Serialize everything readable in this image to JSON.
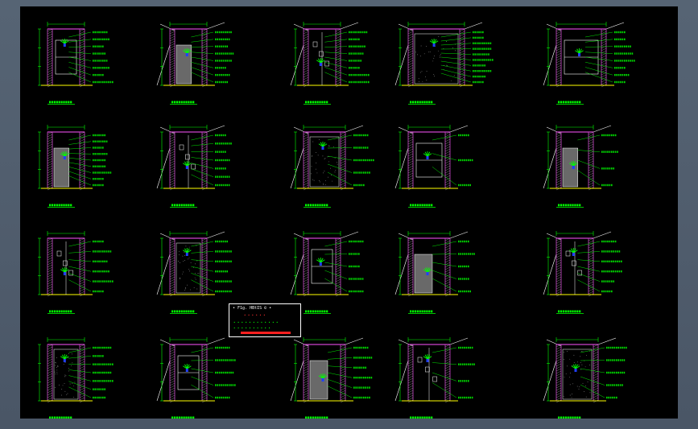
{
  "window": {
    "background": "#4d5a6a",
    "drawing_background": "#000000"
  },
  "colors": {
    "wall": "#cc44cc",
    "wall_hatch": "#ffffff",
    "leader": "#00ff00",
    "dimension": "#00ff00",
    "outline": "#ffffff",
    "accent": "#ff2020",
    "floor": "#ffff00"
  },
  "legend": {
    "line1": "• F1g. HBtIS © •",
    "line2": "• • • • • •",
    "line3": "• • • • • • • • • • • •",
    "line4": "• • • • • • • • • •"
  },
  "grid": {
    "rows": 4,
    "cols": 5
  },
  "icons": [
    "plant-icon",
    "vase-icon"
  ]
}
